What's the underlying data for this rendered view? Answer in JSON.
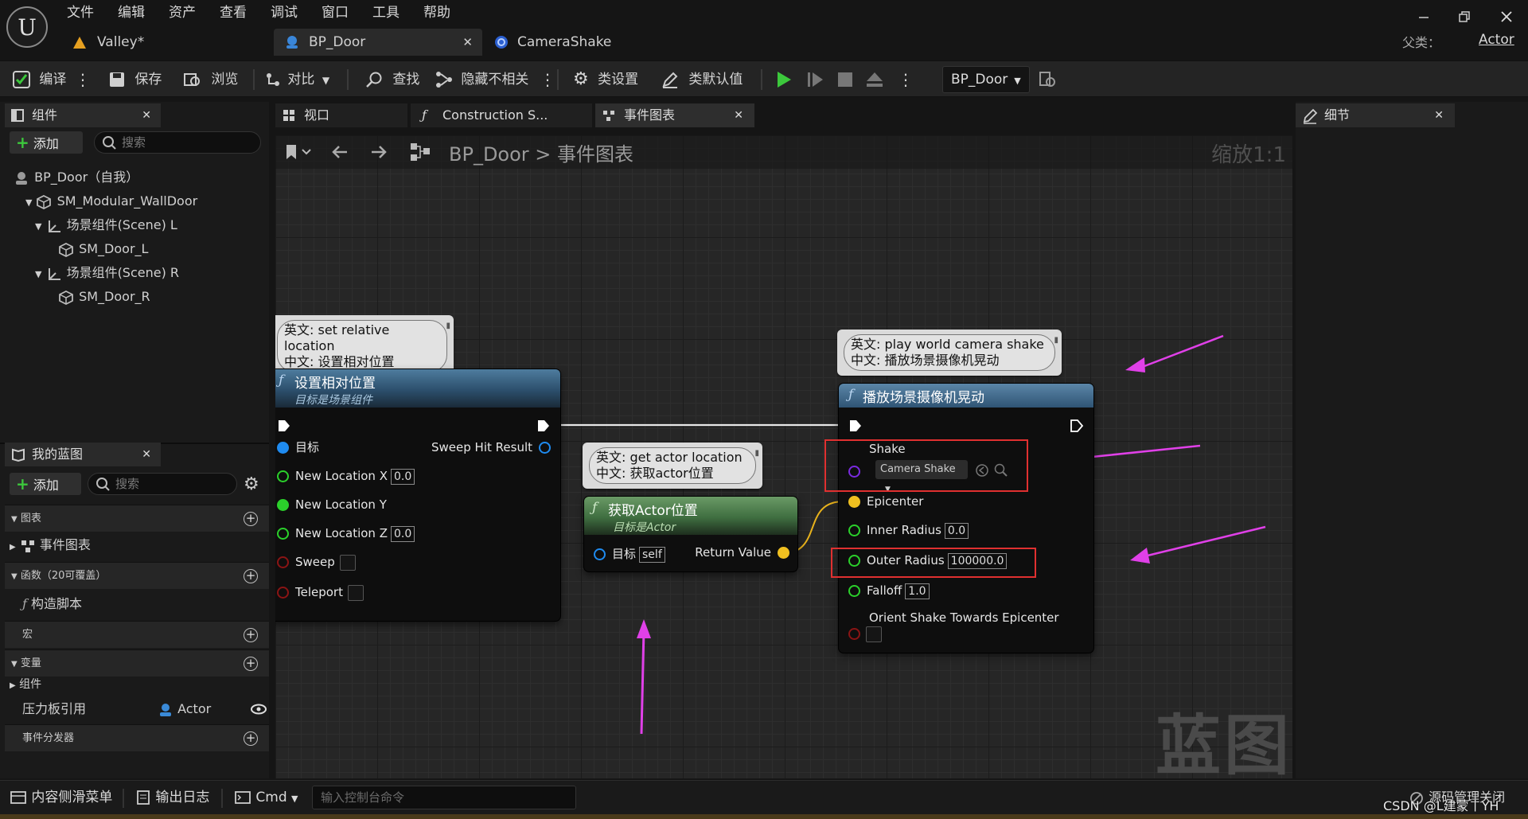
{
  "menu": [
    "文件",
    "编辑",
    "资产",
    "查看",
    "调试",
    "窗口",
    "工具",
    "帮助"
  ],
  "doc_tabs": {
    "valley": "Valley*",
    "bp_door": "BP_Door",
    "camera_shake": "CameraShake"
  },
  "parent_class": {
    "label": "父类：",
    "value": "Actor"
  },
  "toolbar": {
    "compile": "编译",
    "save": "保存",
    "browse": "浏览",
    "diff": "对比",
    "find": "查找",
    "hide_unrelated": "隐藏不相关",
    "class_settings": "类设置",
    "class_defaults": "类默认值",
    "debug_object": "BP_Door"
  },
  "components_panel": {
    "title": "组件",
    "add": "添加",
    "search_placeholder": "搜索",
    "items": [
      "BP_Door（自我）",
      "SM_Modular_WallDoor",
      "场景组件(Scene) L",
      "SM_Door_L",
      "场景组件(Scene) R",
      "SM_Door_R"
    ]
  },
  "my_blueprint": {
    "title": "我的蓝图",
    "add": "添加",
    "search_placeholder": "搜索",
    "graphs_header": "图表",
    "event_graph": "事件图表",
    "functions_header": "函数（20可覆盖）",
    "construction_script": "构造脚本",
    "macros_header": "宏",
    "variables_header": "变量",
    "components_group": "组件",
    "variable": {
      "name": "压力板引用",
      "type": "Actor"
    },
    "dispatchers_header": "事件分发器"
  },
  "editor_tabs": {
    "viewport": "视口",
    "construction": "Construction S...",
    "event_graph": "事件图表"
  },
  "graph": {
    "breadcrumb_root": "BP_Door",
    "breadcrumb_sep": ">",
    "breadcrumb_current": "事件图表",
    "zoom": "缩放1:1",
    "watermark": "蓝图"
  },
  "comments": {
    "c1_en": "英文: set relative location",
    "c1_zh": "中文: 设置相对位置",
    "c2_en": "英文: get actor location",
    "c2_zh": "中文: 获取actor位置",
    "c3_en": "英文: play world camera shake",
    "c3_zh": "中文: 播放场景摄像机晃动"
  },
  "node_set_location": {
    "title": "设置相对位置",
    "subtitle": "目标是场景组件",
    "target": "目标",
    "sweep_hit": "Sweep Hit Result",
    "loc_x": "New Location X",
    "loc_x_val": "0.0",
    "loc_y": "New Location Y",
    "loc_z": "New Location Z",
    "loc_z_val": "0.0",
    "sweep": "Sweep",
    "teleport": "Teleport"
  },
  "node_get_location": {
    "title": "获取Actor位置",
    "subtitle": "目标是Actor",
    "target": "目标",
    "target_val": "self",
    "return": "Return Value"
  },
  "node_camera_shake": {
    "title": "播放场景摄像机晃动",
    "shake": "Shake",
    "shake_val": "Camera Shake",
    "epicenter": "Epicenter",
    "inner": "Inner Radius",
    "inner_val": "0.0",
    "outer": "Outer Radius",
    "outer_val": "100000.0",
    "falloff": "Falloff",
    "falloff_val": "1.0",
    "orient": "Orient Shake Towards Epicenter"
  },
  "details_panel": {
    "title": "细节"
  },
  "bottom": {
    "content_drawer": "内容侧滑菜单",
    "output_log": "输出日志",
    "cmd": "Cmd",
    "console_placeholder": "输入控制台命令",
    "source_control": "源码管理关闭",
    "credit": "CSDN @L建蒙丨YH"
  }
}
